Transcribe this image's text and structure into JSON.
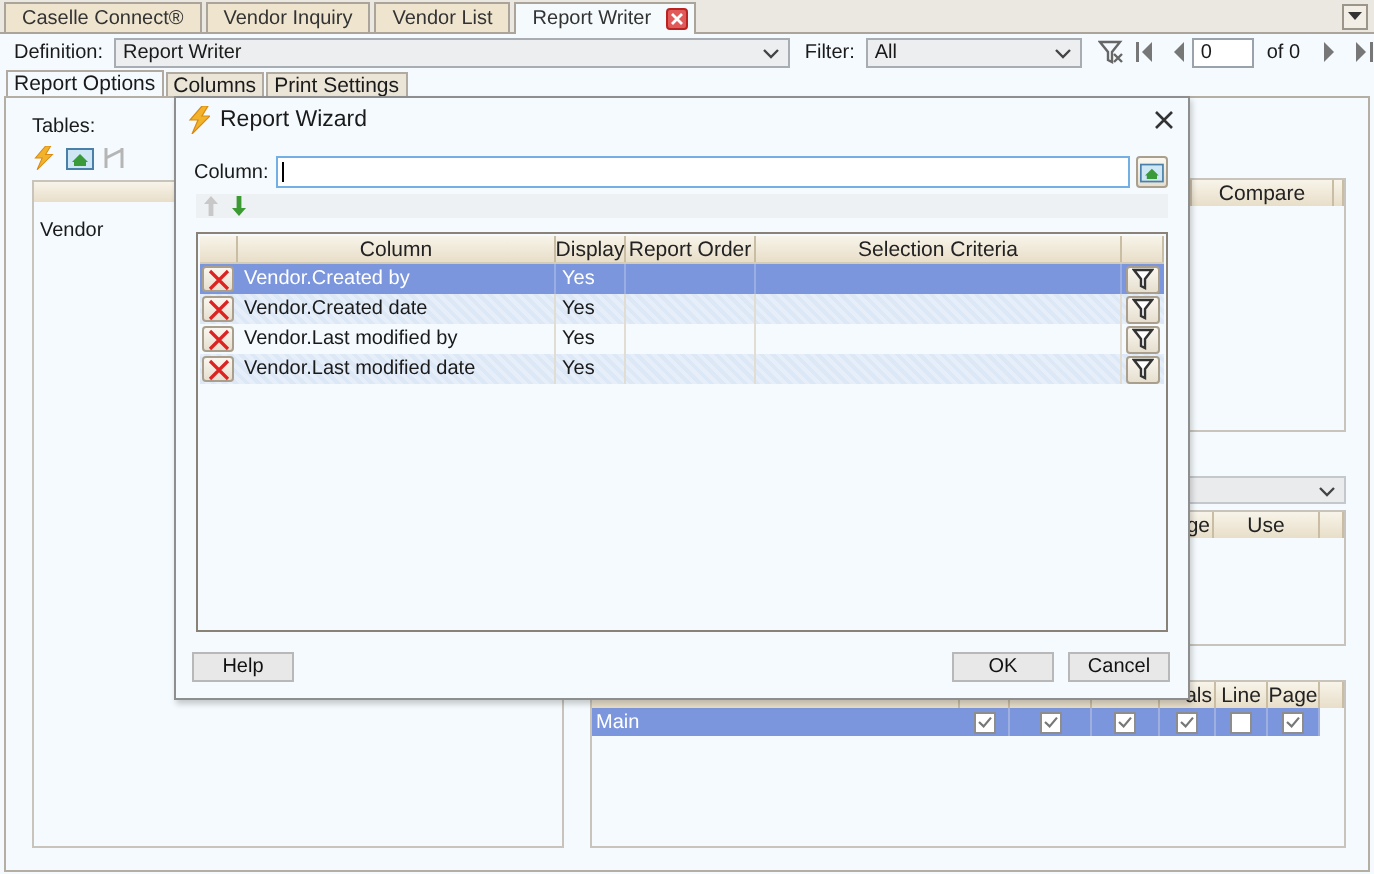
{
  "tabs": [
    {
      "label": "Caselle Connect®",
      "selected": false,
      "closable": false
    },
    {
      "label": "Vendor Inquiry",
      "selected": false,
      "closable": false
    },
    {
      "label": "Vendor List",
      "selected": false,
      "closable": false
    },
    {
      "label": "Report Writer",
      "selected": true,
      "closable": true
    }
  ],
  "toolbar": {
    "definition_label": "Definition:",
    "definition_value": "Report Writer",
    "filter_label": "Filter:",
    "filter_value": "All",
    "record_value": "0",
    "record_count": "of 0"
  },
  "subtabs": [
    {
      "label": "Report Options",
      "selected": true
    },
    {
      "label": "Columns",
      "selected": false
    },
    {
      "label": "Print Settings",
      "selected": false
    }
  ],
  "tables": {
    "label": "Tables:",
    "items": [
      "Vendor"
    ]
  },
  "criteria_grid": {
    "columns": [
      "Compare"
    ]
  },
  "sort_grid": {
    "columns": [
      "ge",
      "Use"
    ]
  },
  "groups_grid": {
    "columns": [
      "als",
      "Line",
      "Page"
    ],
    "rows": [
      {
        "name": "Main",
        "selected": true,
        "checks": [
          true,
          true,
          true,
          true,
          false,
          true
        ]
      }
    ]
  },
  "dialog": {
    "title": "Report Wizard",
    "column_label": "Column:",
    "move_up": {
      "disabled": true
    },
    "move_down": {
      "disabled": false
    },
    "columns": [
      "Column",
      "Display",
      "Report Order",
      "Selection Criteria"
    ],
    "rows": [
      {
        "column": "Vendor.Created by",
        "display": "Yes",
        "selected": true
      },
      {
        "column": "Vendor.Created date",
        "display": "Yes",
        "selected": false
      },
      {
        "column": "Vendor.Last modified by",
        "display": "Yes",
        "selected": false
      },
      {
        "column": "Vendor.Last modified date",
        "display": "Yes",
        "selected": false
      }
    ],
    "buttons": [
      "Help",
      "OK",
      "Cancel"
    ]
  }
}
